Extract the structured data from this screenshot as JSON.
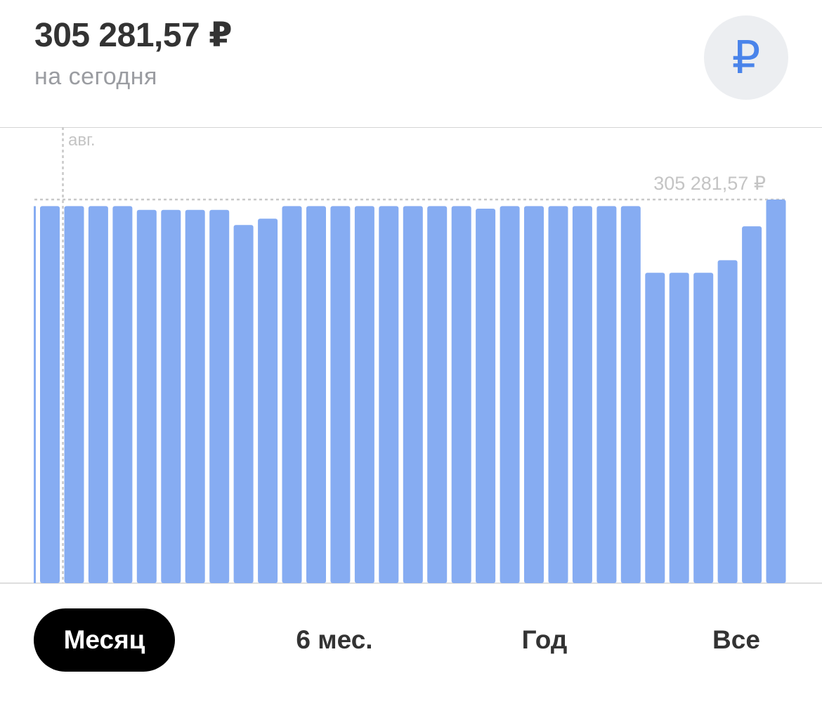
{
  "header": {
    "balance": "305 281,57 ₽",
    "subtitle": "на сегодня",
    "currency_icon": "ruble-icon",
    "currency_glyph": "₽"
  },
  "chart_data": {
    "type": "bar",
    "month_label": "авг.",
    "max_label": "305 281,57 ₽",
    "max_value": 305281.57,
    "colors": {
      "bar": "#86acf2",
      "grid": "#c8c8c8",
      "label": "#c4c4c4"
    },
    "values": [
      300000,
      300000,
      300000,
      300000,
      297000,
      297000,
      297000,
      297000,
      285000,
      290000,
      300000,
      300000,
      300000,
      300000,
      300000,
      300000,
      300000,
      300000,
      298000,
      300000,
      300000,
      300000,
      300000,
      300000,
      300000,
      247000,
      247000,
      247000,
      257000,
      284000,
      305281.57
    ]
  },
  "tabs": [
    {
      "label": "Месяц",
      "active": true
    },
    {
      "label": "6 мес.",
      "active": false
    },
    {
      "label": "Год",
      "active": false
    },
    {
      "label": "Все",
      "active": false
    }
  ]
}
